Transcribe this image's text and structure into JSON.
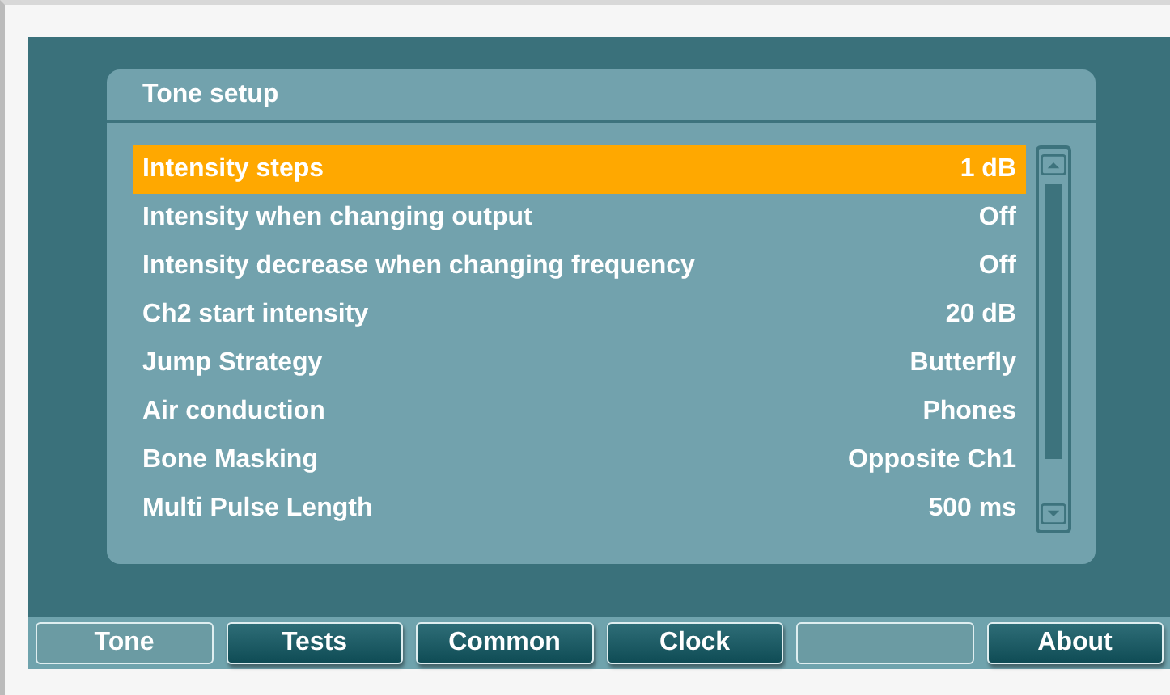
{
  "panel": {
    "title": "Tone setup"
  },
  "settings": [
    {
      "label": "Intensity steps",
      "value": "1 dB",
      "selected": true
    },
    {
      "label": "Intensity when changing output",
      "value": "Off",
      "selected": false
    },
    {
      "label": "Intensity decrease when changing frequency",
      "value": "Off",
      "selected": false
    },
    {
      "label": "Ch2 start intensity",
      "value": "20 dB",
      "selected": false
    },
    {
      "label": "Jump Strategy",
      "value": "Butterfly",
      "selected": false
    },
    {
      "label": "Air conduction",
      "value": "Phones",
      "selected": false
    },
    {
      "label": "Bone Masking",
      "value": "Opposite Ch1",
      "selected": false
    },
    {
      "label": "Multi Pulse Length",
      "value": "500 ms",
      "selected": false
    }
  ],
  "buttons": [
    {
      "label": "Tone",
      "selected": true
    },
    {
      "label": "Tests",
      "selected": false
    },
    {
      "label": "Common",
      "selected": false
    },
    {
      "label": "Clock",
      "selected": false
    },
    {
      "kind": "blank"
    },
    {
      "label": "About",
      "selected": false
    }
  ]
}
